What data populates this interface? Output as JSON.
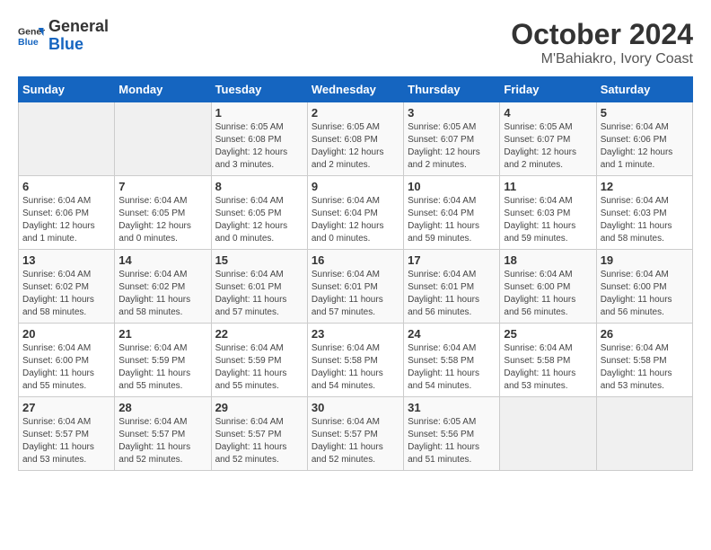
{
  "header": {
    "logo_line1": "General",
    "logo_line2": "Blue",
    "title": "October 2024",
    "subtitle": "M'Bahiakro, Ivory Coast"
  },
  "calendar": {
    "days_of_week": [
      "Sunday",
      "Monday",
      "Tuesday",
      "Wednesday",
      "Thursday",
      "Friday",
      "Saturday"
    ],
    "weeks": [
      [
        {
          "num": "",
          "detail": ""
        },
        {
          "num": "",
          "detail": ""
        },
        {
          "num": "1",
          "detail": "Sunrise: 6:05 AM\nSunset: 6:08 PM\nDaylight: 12 hours\nand 3 minutes."
        },
        {
          "num": "2",
          "detail": "Sunrise: 6:05 AM\nSunset: 6:08 PM\nDaylight: 12 hours\nand 2 minutes."
        },
        {
          "num": "3",
          "detail": "Sunrise: 6:05 AM\nSunset: 6:07 PM\nDaylight: 12 hours\nand 2 minutes."
        },
        {
          "num": "4",
          "detail": "Sunrise: 6:05 AM\nSunset: 6:07 PM\nDaylight: 12 hours\nand 2 minutes."
        },
        {
          "num": "5",
          "detail": "Sunrise: 6:04 AM\nSunset: 6:06 PM\nDaylight: 12 hours\nand 1 minute."
        }
      ],
      [
        {
          "num": "6",
          "detail": "Sunrise: 6:04 AM\nSunset: 6:06 PM\nDaylight: 12 hours\nand 1 minute."
        },
        {
          "num": "7",
          "detail": "Sunrise: 6:04 AM\nSunset: 6:05 PM\nDaylight: 12 hours\nand 0 minutes."
        },
        {
          "num": "8",
          "detail": "Sunrise: 6:04 AM\nSunset: 6:05 PM\nDaylight: 12 hours\nand 0 minutes."
        },
        {
          "num": "9",
          "detail": "Sunrise: 6:04 AM\nSunset: 6:04 PM\nDaylight: 12 hours\nand 0 minutes."
        },
        {
          "num": "10",
          "detail": "Sunrise: 6:04 AM\nSunset: 6:04 PM\nDaylight: 11 hours\nand 59 minutes."
        },
        {
          "num": "11",
          "detail": "Sunrise: 6:04 AM\nSunset: 6:03 PM\nDaylight: 11 hours\nand 59 minutes."
        },
        {
          "num": "12",
          "detail": "Sunrise: 6:04 AM\nSunset: 6:03 PM\nDaylight: 11 hours\nand 58 minutes."
        }
      ],
      [
        {
          "num": "13",
          "detail": "Sunrise: 6:04 AM\nSunset: 6:02 PM\nDaylight: 11 hours\nand 58 minutes."
        },
        {
          "num": "14",
          "detail": "Sunrise: 6:04 AM\nSunset: 6:02 PM\nDaylight: 11 hours\nand 58 minutes."
        },
        {
          "num": "15",
          "detail": "Sunrise: 6:04 AM\nSunset: 6:01 PM\nDaylight: 11 hours\nand 57 minutes."
        },
        {
          "num": "16",
          "detail": "Sunrise: 6:04 AM\nSunset: 6:01 PM\nDaylight: 11 hours\nand 57 minutes."
        },
        {
          "num": "17",
          "detail": "Sunrise: 6:04 AM\nSunset: 6:01 PM\nDaylight: 11 hours\nand 56 minutes."
        },
        {
          "num": "18",
          "detail": "Sunrise: 6:04 AM\nSunset: 6:00 PM\nDaylight: 11 hours\nand 56 minutes."
        },
        {
          "num": "19",
          "detail": "Sunrise: 6:04 AM\nSunset: 6:00 PM\nDaylight: 11 hours\nand 56 minutes."
        }
      ],
      [
        {
          "num": "20",
          "detail": "Sunrise: 6:04 AM\nSunset: 6:00 PM\nDaylight: 11 hours\nand 55 minutes."
        },
        {
          "num": "21",
          "detail": "Sunrise: 6:04 AM\nSunset: 5:59 PM\nDaylight: 11 hours\nand 55 minutes."
        },
        {
          "num": "22",
          "detail": "Sunrise: 6:04 AM\nSunset: 5:59 PM\nDaylight: 11 hours\nand 55 minutes."
        },
        {
          "num": "23",
          "detail": "Sunrise: 6:04 AM\nSunset: 5:58 PM\nDaylight: 11 hours\nand 54 minutes."
        },
        {
          "num": "24",
          "detail": "Sunrise: 6:04 AM\nSunset: 5:58 PM\nDaylight: 11 hours\nand 54 minutes."
        },
        {
          "num": "25",
          "detail": "Sunrise: 6:04 AM\nSunset: 5:58 PM\nDaylight: 11 hours\nand 53 minutes."
        },
        {
          "num": "26",
          "detail": "Sunrise: 6:04 AM\nSunset: 5:58 PM\nDaylight: 11 hours\nand 53 minutes."
        }
      ],
      [
        {
          "num": "27",
          "detail": "Sunrise: 6:04 AM\nSunset: 5:57 PM\nDaylight: 11 hours\nand 53 minutes."
        },
        {
          "num": "28",
          "detail": "Sunrise: 6:04 AM\nSunset: 5:57 PM\nDaylight: 11 hours\nand 52 minutes."
        },
        {
          "num": "29",
          "detail": "Sunrise: 6:04 AM\nSunset: 5:57 PM\nDaylight: 11 hours\nand 52 minutes."
        },
        {
          "num": "30",
          "detail": "Sunrise: 6:04 AM\nSunset: 5:57 PM\nDaylight: 11 hours\nand 52 minutes."
        },
        {
          "num": "31",
          "detail": "Sunrise: 6:05 AM\nSunset: 5:56 PM\nDaylight: 11 hours\nand 51 minutes."
        },
        {
          "num": "",
          "detail": ""
        },
        {
          "num": "",
          "detail": ""
        }
      ]
    ]
  }
}
